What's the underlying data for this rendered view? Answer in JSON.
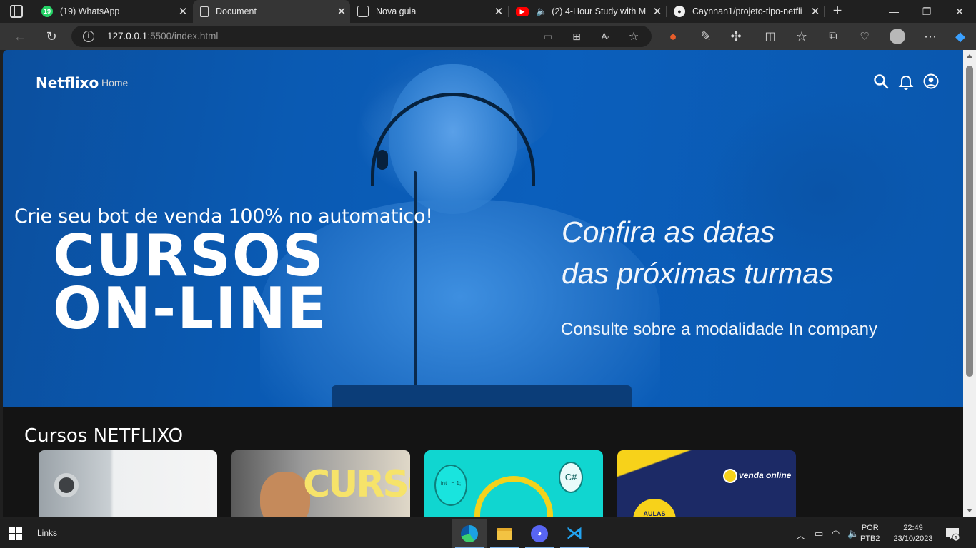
{
  "browser": {
    "tabs": [
      {
        "title": "(19) WhatsApp",
        "badge": "19",
        "icon": "whatsapp-icon",
        "active": false
      },
      {
        "title": "Document",
        "icon": "document-icon",
        "active": true
      },
      {
        "title": "Nova guia",
        "icon": "new-tab-page-icon",
        "active": false
      },
      {
        "title": "(2) 4-Hour Study with M",
        "icon": "youtube-icon",
        "active": false,
        "audio": true
      },
      {
        "title": "Caynnan1/projeto-tipo-netfli",
        "icon": "github-icon",
        "active": false
      }
    ],
    "url_host": "127.0.0.1",
    "url_rest": ":5500/index.html"
  },
  "site": {
    "logo": "Netflixo",
    "nav_home": "Home",
    "hero": {
      "promo": "Crie seu bot de venda 100% no automatico!",
      "cursos_line1": "CURSOS",
      "cursos_line2": "ON-LINE",
      "confira_line1": "Confira as datas",
      "confira_line2": "das próximas turmas",
      "consulte": "Consulte sobre a modalidade In company"
    },
    "courses_title": "Cursos NETFLIXO",
    "cards": [
      {
        "icon": "course-thumbnail-1"
      },
      {
        "text": "CURSOS",
        "icon": "course-thumbnail-2"
      },
      {
        "b1": "int i = 1;",
        "b2": "C#",
        "icon": "course-thumbnail-3"
      },
      {
        "brand": "venda online",
        "badge": "AULAS",
        "icon": "course-thumbnail-4"
      }
    ]
  },
  "taskbar": {
    "links_label": "Links",
    "lang_line1": "POR",
    "lang_line2": "PTB2",
    "time": "22:49",
    "date": "23/10/2023",
    "notification_count": "1"
  },
  "colors": {
    "hero_blue": "#0a5ab3",
    "page_bg": "#141414",
    "browser_bg": "#202020",
    "toolbar_bg": "#353535"
  }
}
